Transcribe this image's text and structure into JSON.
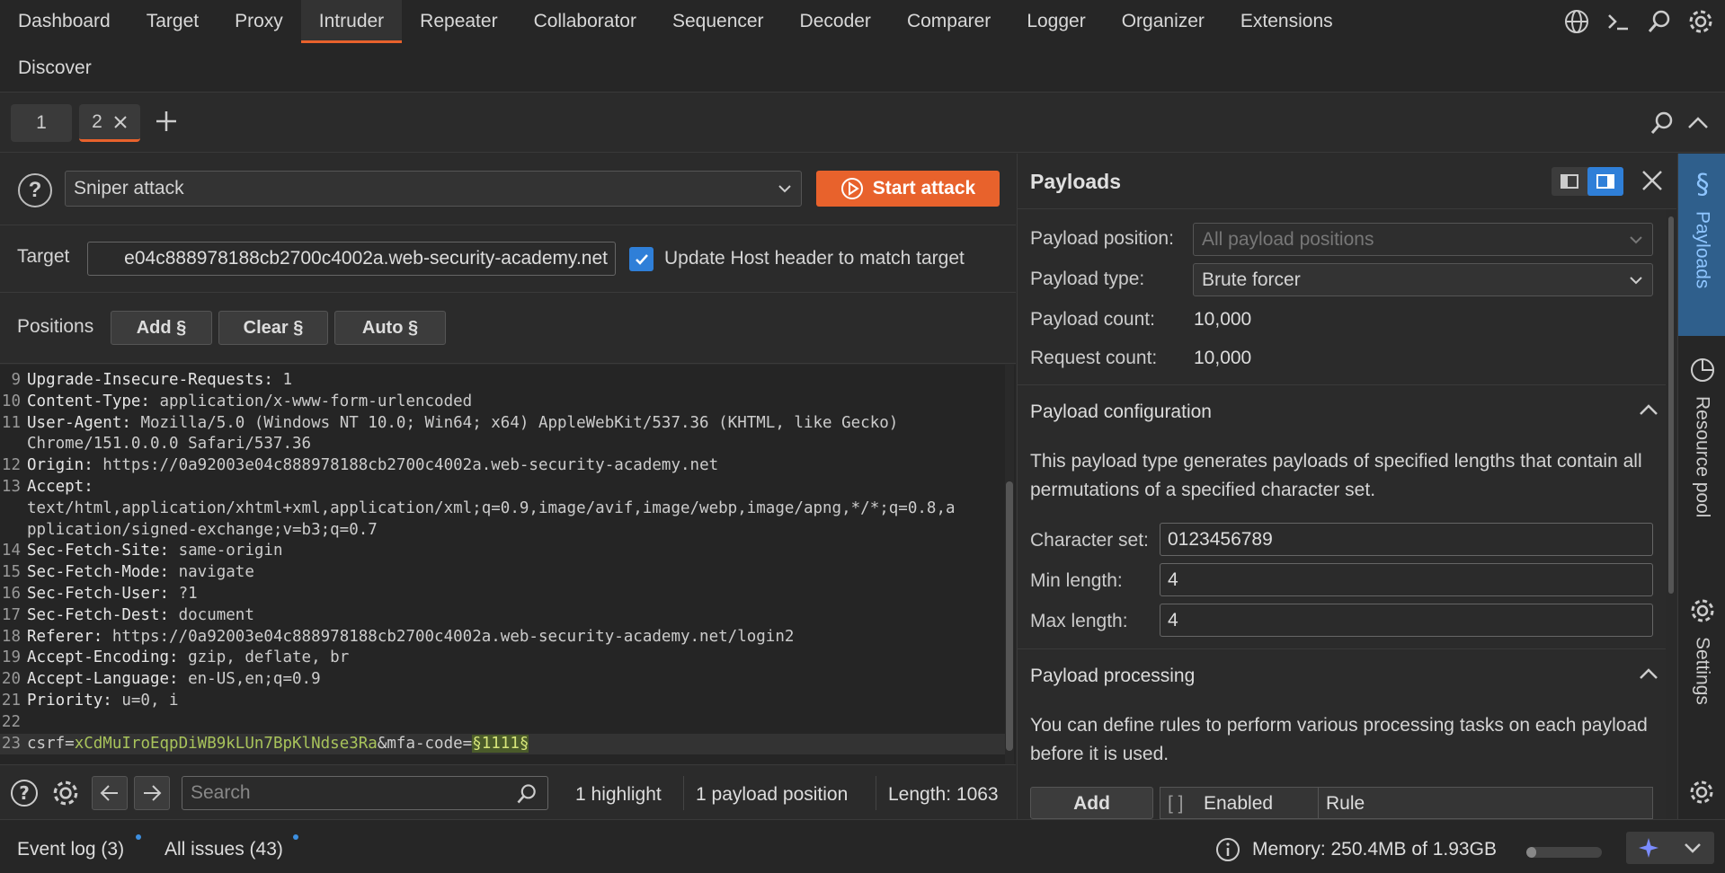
{
  "menu": {
    "items": [
      "Dashboard",
      "Target",
      "Proxy",
      "Intruder",
      "Repeater",
      "Collaborator",
      "Sequencer",
      "Decoder",
      "Comparer",
      "Logger",
      "Organizer",
      "Extensions"
    ],
    "active": "Intruder",
    "discover": "Discover"
  },
  "tabs": {
    "tab1": "1",
    "tab2": "2"
  },
  "attack": {
    "type": "Sniper attack",
    "start_label": "Start attack"
  },
  "target": {
    "label": "Target",
    "value": "e04c888978188cb2700c4002a.web-security-academy.net",
    "update_host_label": "Update Host header to match target",
    "update_host_checked": true
  },
  "positions": {
    "label": "Positions",
    "add": "Add §",
    "clear": "Clear §",
    "auto": "Auto §"
  },
  "editor": {
    "lines": [
      {
        "n": "9",
        "key": "Upgrade-Insecure-Requests:",
        "val": " 1"
      },
      {
        "n": "10",
        "key": "Content-Type:",
        "val": " application/x-www-form-urlencoded"
      },
      {
        "n": "11",
        "key": "User-Agent:",
        "val": " Mozilla/5.0 (Windows NT 10.0; Win64; x64) AppleWebKit/537.36 (KHTML, like Gecko)"
      },
      {
        "n": "",
        "key": "",
        "val": "Chrome/151.0.0.0 Safari/537.36"
      },
      {
        "n": "12",
        "key": "Origin:",
        "val": " https://0a92003e04c888978188cb2700c4002a.web-security-academy.net"
      },
      {
        "n": "13",
        "key": "Accept:",
        "val": ""
      },
      {
        "n": "",
        "key": "",
        "val": "text/html,application/xhtml+xml,application/xml;q=0.9,image/avif,image/webp,image/apng,*/*;q=0.8,a"
      },
      {
        "n": "",
        "key": "",
        "val": "pplication/signed-exchange;v=b3;q=0.7"
      },
      {
        "n": "14",
        "key": "Sec-Fetch-Site:",
        "val": " same-origin"
      },
      {
        "n": "15",
        "key": "Sec-Fetch-Mode:",
        "val": " navigate"
      },
      {
        "n": "16",
        "key": "Sec-Fetch-User:",
        "val": " ?1"
      },
      {
        "n": "17",
        "key": "Sec-Fetch-Dest:",
        "val": " document"
      },
      {
        "n": "18",
        "key": "Referer:",
        "val": " https://0a92003e04c888978188cb2700c4002a.web-security-academy.net/login2"
      },
      {
        "n": "19",
        "key": "Accept-Encoding:",
        "val": " gzip, deflate, br"
      },
      {
        "n": "20",
        "key": "Accept-Language:",
        "val": " en-US,en;q=0.9"
      },
      {
        "n": "21",
        "key": "Priority:",
        "val": " u=0, i"
      },
      {
        "n": "22",
        "key": "",
        "val": ""
      }
    ],
    "body_line": {
      "n": "23",
      "p1": "csrf=",
      "csrf": "xCdMuIroEqpDiWB9kLUn7BpKlNdse3Ra",
      "p2": "&mfa-code=",
      "marker": "§1111§"
    }
  },
  "bottom": {
    "search_placeholder": "Search",
    "highlights": "1 highlight",
    "payload_positions": "1 payload position",
    "length": "Length: 1063"
  },
  "payloads_panel": {
    "title": "Payloads",
    "position_label": "Payload position:",
    "position_value": "All payload positions",
    "type_label": "Payload type:",
    "type_value": "Brute forcer",
    "count_label": "Payload count:",
    "count_value": "10,000",
    "request_label": "Request count:",
    "request_value": "10,000",
    "config_title": "Payload configuration",
    "config_desc": "This payload type generates payloads of specified lengths that contain all permutations of a specified character set.",
    "charset_label": "Character set:",
    "charset_value": "0123456789",
    "min_label": "Min length:",
    "min_value": "4",
    "max_label": "Max length:",
    "max_value": "4",
    "processing_title": "Payload processing",
    "processing_desc": "You can define rules to perform various processing tasks on each payload before it is used.",
    "add_label": "Add",
    "col_enabled": "Enabled",
    "col_rule": "Rule"
  },
  "rail": {
    "payloads": "Payloads",
    "resource_pool": "Resource pool",
    "settings": "Settings"
  },
  "status": {
    "event_log": "Event log (3)",
    "all_issues": "All issues (43)",
    "memory": "Memory: 250.4MB of 1.93GB",
    "memory_fraction": 0.13
  },
  "colors": {
    "accent": "#e8622c",
    "blue": "#2f7fd8"
  }
}
